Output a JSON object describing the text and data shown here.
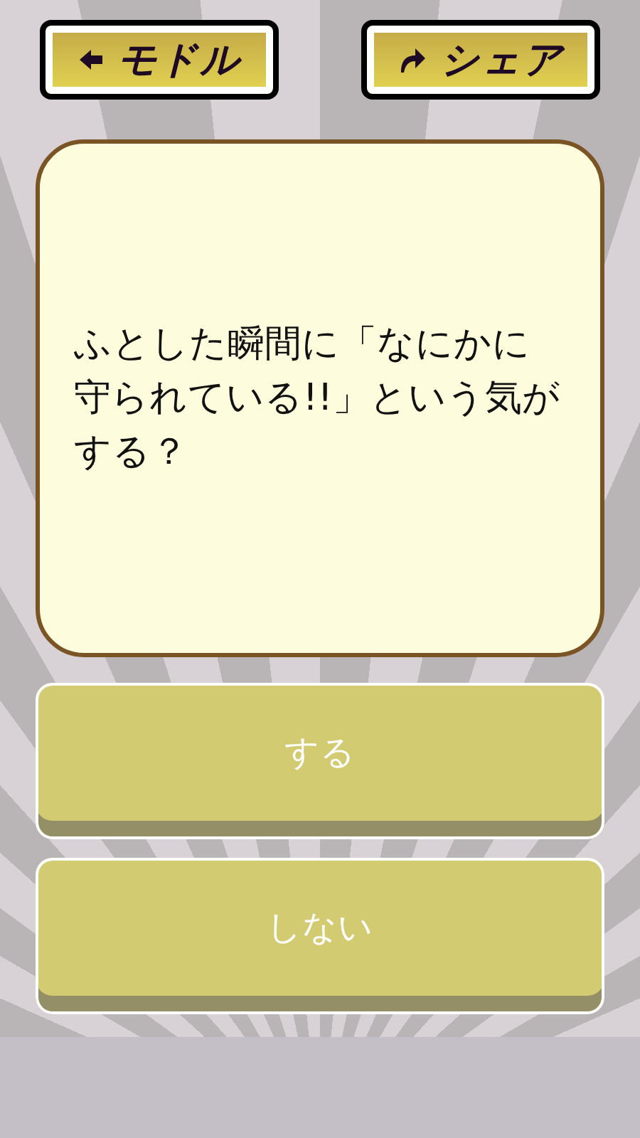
{
  "top_buttons": [
    {
      "label": "モドル",
      "kind": "back"
    },
    {
      "label": "シェア",
      "kind": "share"
    }
  ],
  "question": "ふとした瞬間に「なにかに守られている!!」という気がする？",
  "answers": [
    {
      "label": "する"
    },
    {
      "label": "しない"
    }
  ]
}
